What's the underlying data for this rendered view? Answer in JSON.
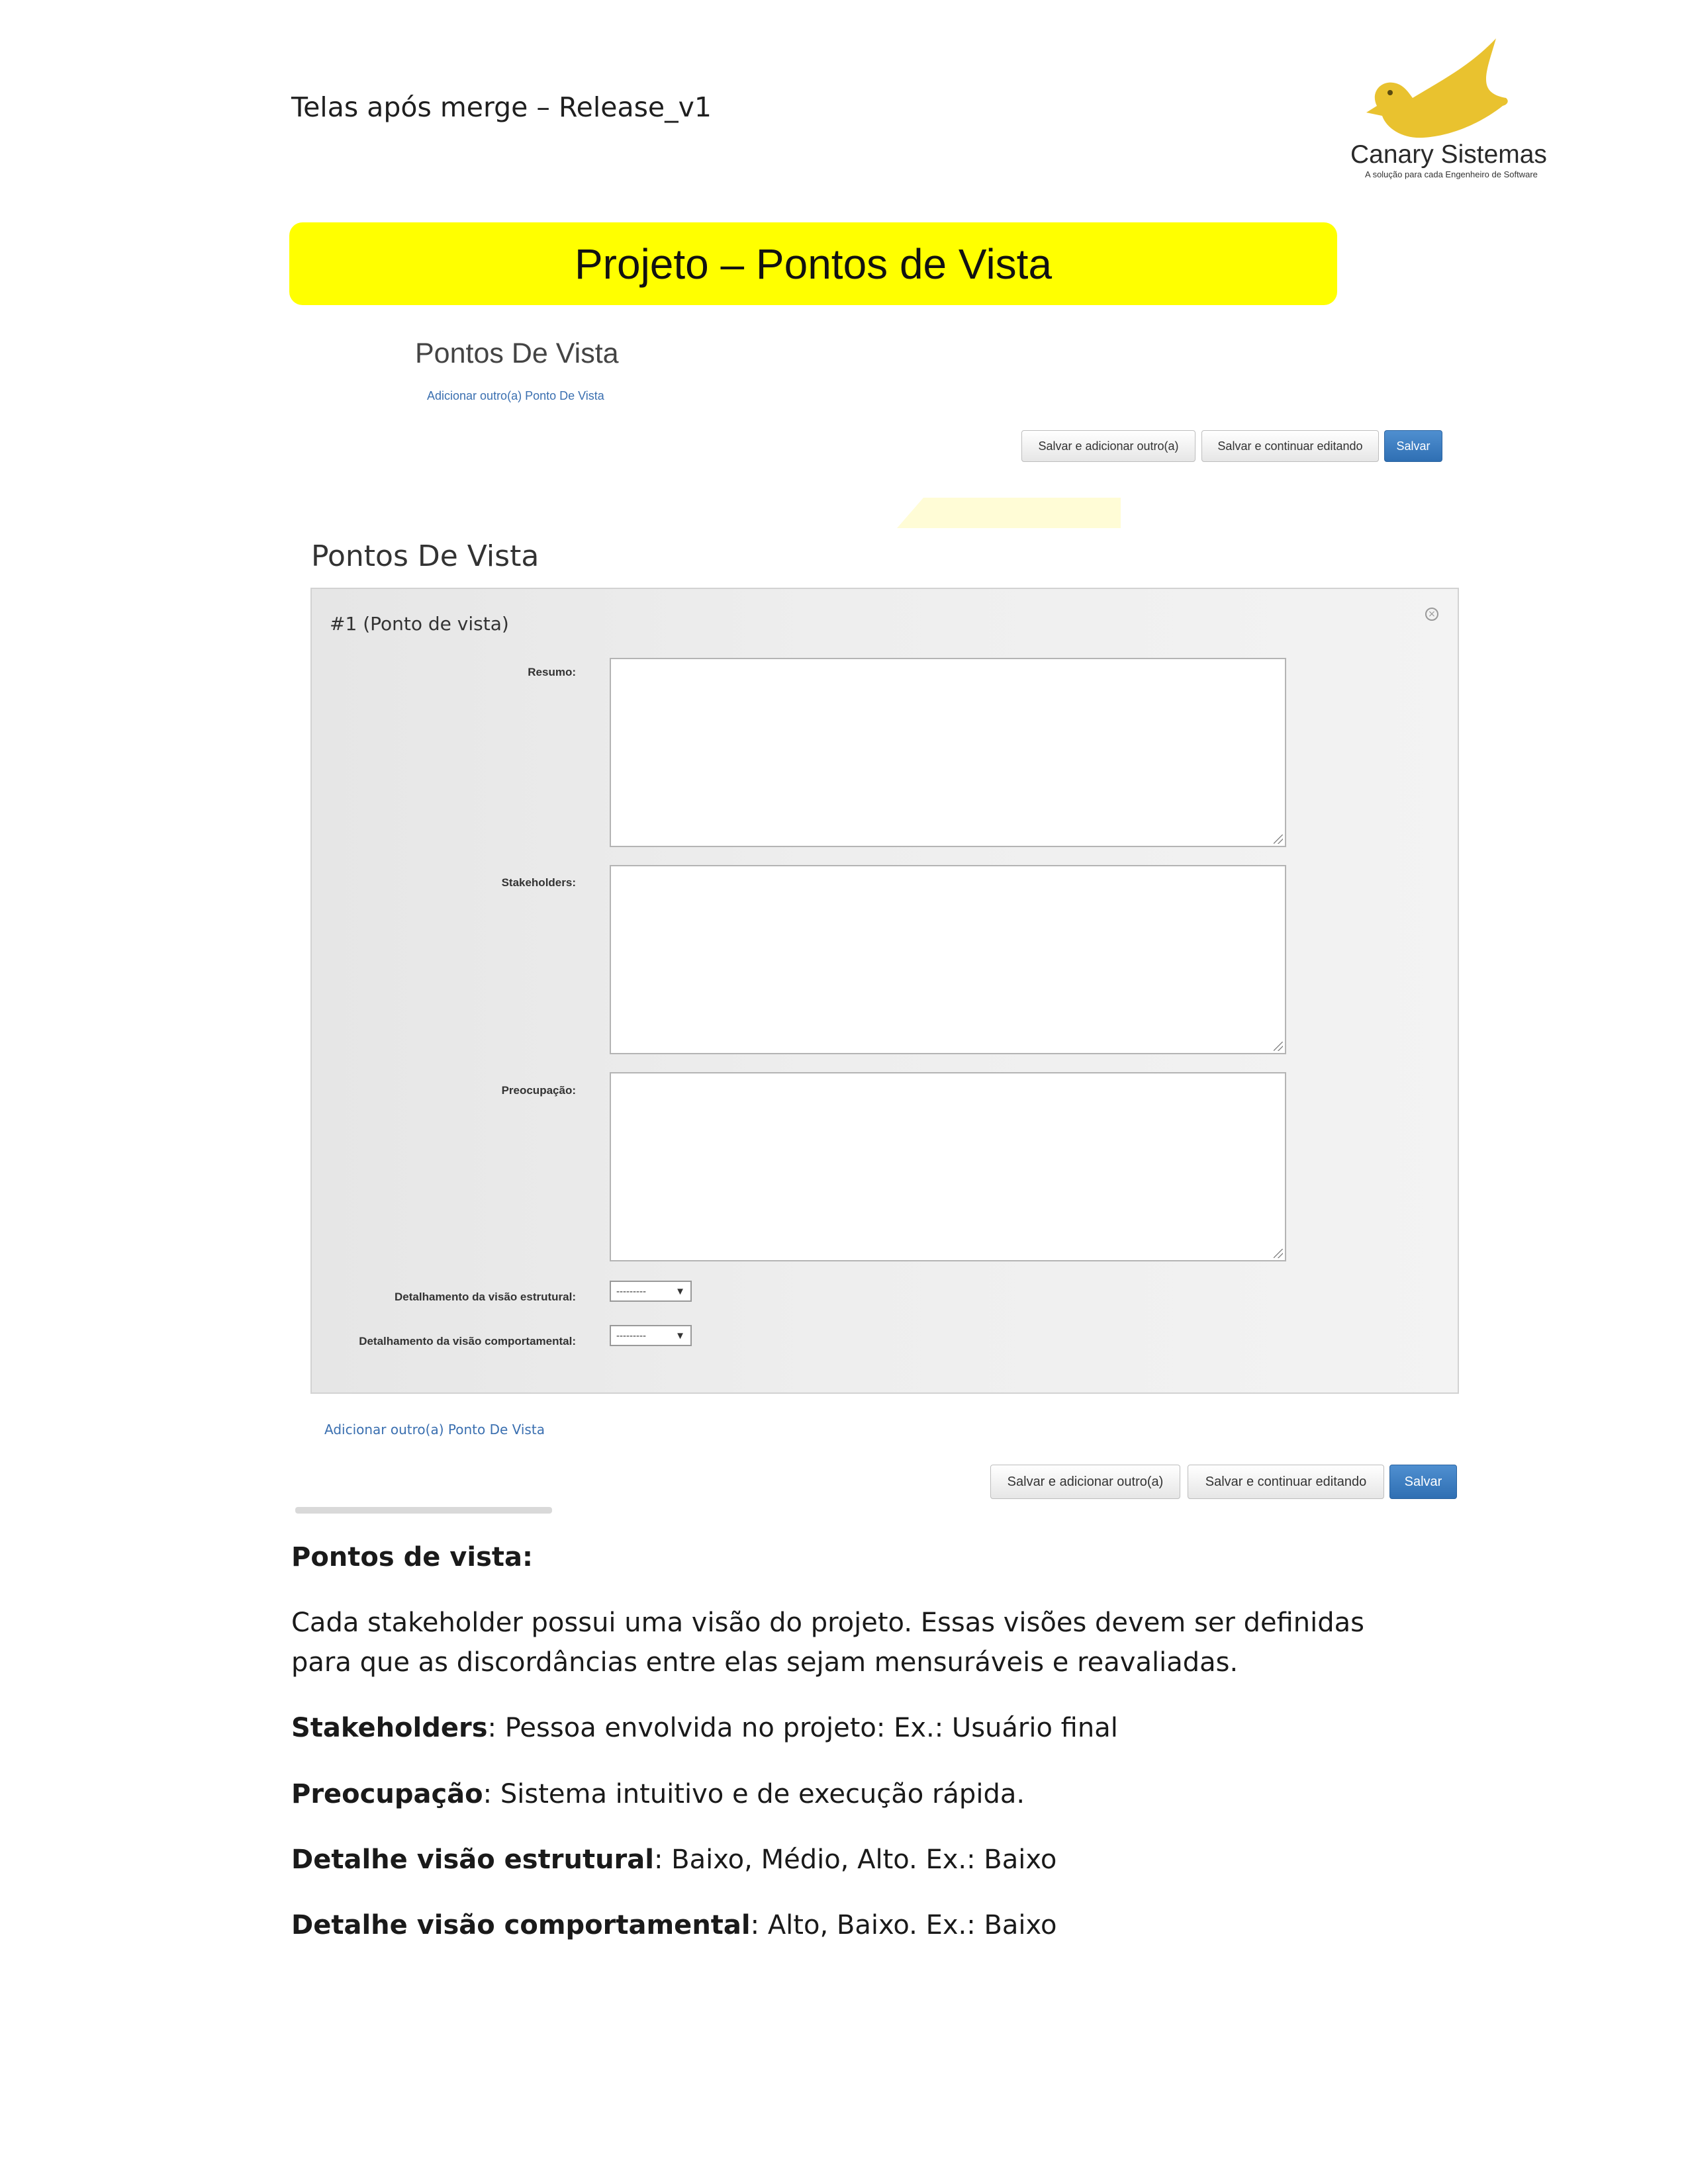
{
  "header": {
    "text": "Telas após merge – Release_v1"
  },
  "logo": {
    "name": "Canary Sistemas",
    "tagline": "A solução para cada Engenheiro de Software",
    "color": "#e9c22f"
  },
  "title": "Projeto – Pontos de Vista",
  "small_screen": {
    "title": "Pontos De Vista",
    "add_link": "Adicionar outro(a) Ponto De Vista",
    "buttons": {
      "save_add": "Salvar e adicionar outro(a)",
      "save_continue": "Salvar e continuar editando",
      "save": "Salvar"
    }
  },
  "main_screen": {
    "title": "Pontos De Vista",
    "panel_number": "#1",
    "panel_type": "(Ponto de vista)",
    "fields": {
      "resumo": "Resumo:",
      "stakeholders": "Stakeholders:",
      "preocupacao": "Preocupação:",
      "estrutural": "Detalhamento da visão estrutural:",
      "comportamental": "Detalhamento da visão comportamental:"
    },
    "select_value": "---------",
    "add_link": "Adicionar outro(a) Ponto De Vista",
    "buttons": {
      "save_add": "Salvar e adicionar outro(a)",
      "save_continue": "Salvar e continuar editando",
      "save": "Salvar"
    }
  },
  "content": {
    "heading": "Pontos de vista:",
    "intro": "Cada stakeholder possui uma visão do projeto. Essas visões devem ser definidas para que as discordâncias entre elas sejam mensuráveis e reavaliadas.",
    "items": [
      {
        "label": "Stakeholders",
        "text": ": Pessoa envolvida no projeto: Ex.: Usuário final"
      },
      {
        "label": "Preocupação",
        "text": ": Sistema intuitivo e de execução rápida."
      },
      {
        "label": "Detalhe visão estrutural",
        "text": ": Baixo, Médio, Alto. Ex.: Baixo"
      },
      {
        "label": "Detalhe visão comportamental",
        "text": ": Alto, Baixo. Ex.: Baixo"
      }
    ]
  }
}
